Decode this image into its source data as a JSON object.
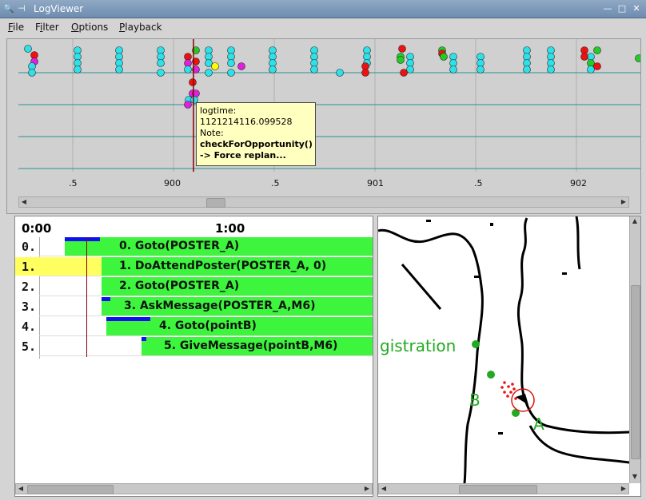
{
  "window": {
    "title": "LogViewer"
  },
  "menu": {
    "items": [
      {
        "label": "File",
        "key": "F"
      },
      {
        "label": "Filter",
        "key": "i"
      },
      {
        "label": "Options",
        "key": "O"
      },
      {
        "label": "Playback",
        "key": "P"
      }
    ]
  },
  "timeline": {
    "ticks": [
      ".5",
      "900",
      ".5",
      "901",
      ".5",
      "902"
    ],
    "tooltip": {
      "line1": "logtime:",
      "line2": "1121214116.099528",
      "line3": "Note:",
      "line4": "checkForOpportunity()",
      "line5": "-> Force replan..."
    },
    "colors": {
      "cyan": "#2ee0e8",
      "red": "#ee1111",
      "magenta": "#e020e0",
      "green": "#22cc22",
      "yellow": "#ffff00",
      "cursor": "#8b0000"
    }
  },
  "tasks": {
    "time_start": "0:00",
    "time_mid": "1:00",
    "rows": [
      {
        "num": "0.",
        "label": "0. Goto(POSTER_A)",
        "progress": 0.4
      },
      {
        "num": "1.",
        "label": "1. DoAttendPoster(POSTER_A, 0)",
        "progress": 0
      },
      {
        "num": "2.",
        "label": "2. Goto(POSTER_A)",
        "progress": 0
      },
      {
        "num": "3.",
        "label": "3. AskMessage(POSTER_A,M6)",
        "progress": 0.1
      },
      {
        "num": "4.",
        "label": "4. Goto(pointB)",
        "progress": 0.5
      },
      {
        "num": "5.",
        "label": "5. GiveMessage(pointB,M6)",
        "progress": 0.05
      }
    ],
    "colors": {
      "bar": "#3cf53c",
      "progress": "#1010ee",
      "highlight": "#ffff60"
    }
  },
  "map": {
    "label_registration": "gistration",
    "label_b": "B",
    "label_a": "A",
    "label_color": "#22aa22"
  }
}
